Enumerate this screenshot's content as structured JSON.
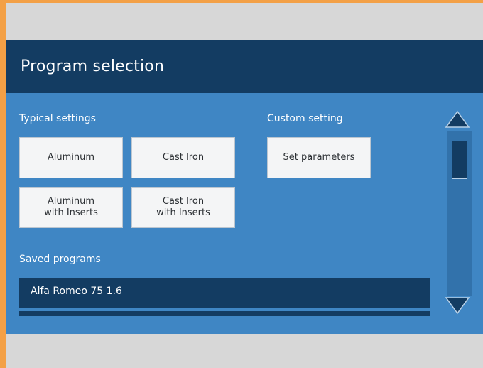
{
  "header": {
    "title": "Program selection"
  },
  "typical": {
    "label": "Typical settings",
    "buttons": {
      "aluminum": "Aluminum",
      "cast_iron": "Cast Iron",
      "aluminum_inserts": "Aluminum\nwith Inserts",
      "cast_iron_inserts": "Cast Iron\nwith Inserts"
    }
  },
  "custom": {
    "label": "Custom setting",
    "button": "Set parameters"
  },
  "saved": {
    "label": "Saved programs",
    "items": [
      "Alfa Romeo 75 1.6"
    ]
  },
  "icons": {
    "scroll_up": "triangle-up-icon",
    "scroll_down": "triangle-down-icon"
  },
  "colors": {
    "header_bg": "#133c62",
    "panel_bg": "#3f86c4",
    "frame_bg": "#d7d7d7",
    "border_accent": "#f3a046"
  }
}
